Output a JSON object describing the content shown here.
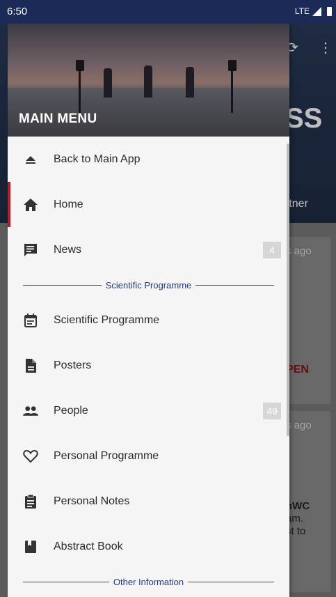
{
  "status_bar": {
    "time": "6:50",
    "network": "LTE"
  },
  "background_app": {
    "banner_text": "SS",
    "partner_text": "rtner",
    "cards": [
      {
        "time": "s ago",
        "open": "PEN"
      },
      {
        "time": "s ago",
        "text1": "nWC",
        "text2": "am.",
        "text3": "st to"
      }
    ]
  },
  "drawer": {
    "title": "MAIN MENU",
    "items": [
      {
        "label": "Back to Main App",
        "icon": "eject-icon"
      },
      {
        "label": "Home",
        "icon": "home-icon",
        "active": true
      },
      {
        "label": "News",
        "icon": "chat-icon",
        "badge": "4"
      }
    ],
    "section1": "Scientific Programme",
    "items2": [
      {
        "label": "Scientific Programme",
        "icon": "calendar-icon"
      },
      {
        "label": "Posters",
        "icon": "document-icon"
      },
      {
        "label": "People",
        "icon": "people-icon",
        "badge": "49"
      },
      {
        "label": "Personal Programme",
        "icon": "heart-icon"
      },
      {
        "label": "Personal Notes",
        "icon": "clipboard-icon"
      },
      {
        "label": "Abstract Book",
        "icon": "book-icon"
      }
    ],
    "section2": "Other Information"
  },
  "colors": {
    "accent_red": "#c4161c",
    "section_blue": "#1d3c8a",
    "status_bar": "#1b2a57"
  }
}
